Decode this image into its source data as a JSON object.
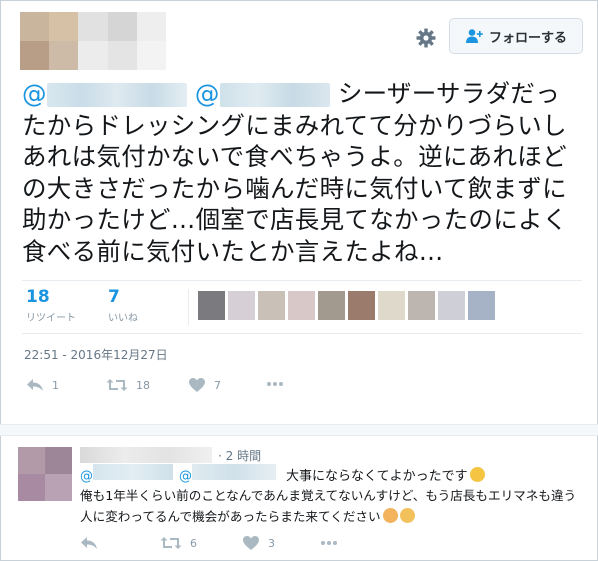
{
  "header": {
    "avatar_colors": [
      "#c9b49e",
      "#d7c1a6",
      "#e1e1e1",
      "#d5d5d5",
      "#eeeeee",
      "#b89e86",
      "#cdbba7",
      "#ececec",
      "#e4e4e4",
      "#f3f3f3"
    ],
    "settings_icon": "gear-icon",
    "follow_icon": "person-plus-icon",
    "follow_label": "フォローする"
  },
  "tweet": {
    "mention_prefix_1": "@",
    "mention_prefix_2": "@",
    "text": "シーザーサラダだったからドレッシングにまみれてて分かりづらいしあれは気付かないで食べちゃうよ。逆にあれほどの大きさだったから噛んだ時に気付いて飲まずに助かったけど…個室で店長見てなかったのによく食べる前に気付いたとか言えたよね…"
  },
  "stats": {
    "retweets_count": "18",
    "retweets_label": "リツイート",
    "likes_count": "7",
    "likes_label": "いいね",
    "liker_colors": [
      "#7b7b7f",
      "#d6cfd6",
      "#c9c1b8",
      "#d9c8c8",
      "#a39a8f",
      "#9b7b6b",
      "#dfd9cc",
      "#bdb6b0",
      "#cfcfd7",
      "#a6b2c6"
    ]
  },
  "timestamp": "22:51 - 2016年12月27日",
  "actions": {
    "reply_count": "1",
    "retweet_count": "18",
    "like_count": "7",
    "icons": [
      "reply-icon",
      "retweet-icon",
      "heart-icon",
      "more-icon"
    ]
  },
  "reply": {
    "avatar_colors": [
      "#b29aa9",
      "#9c8698",
      "#a98aa3",
      "#b8a2b3"
    ],
    "time": "· 2 時間",
    "mention_prefix_1": "@",
    "mention_prefix_2": "@",
    "line1_text": "大事にならなくてよかったです",
    "body": "俺も1年半くらい前のことなんであんま覚えてないんすけど、もう店長もエリマネも違う人に変わってるんで機会があったらまた来てください",
    "retweet_count": "6",
    "like_count": "3"
  },
  "colors": {
    "accent": "#1b95e0",
    "muted": "#8899a6",
    "border": "#e6ecf0"
  }
}
